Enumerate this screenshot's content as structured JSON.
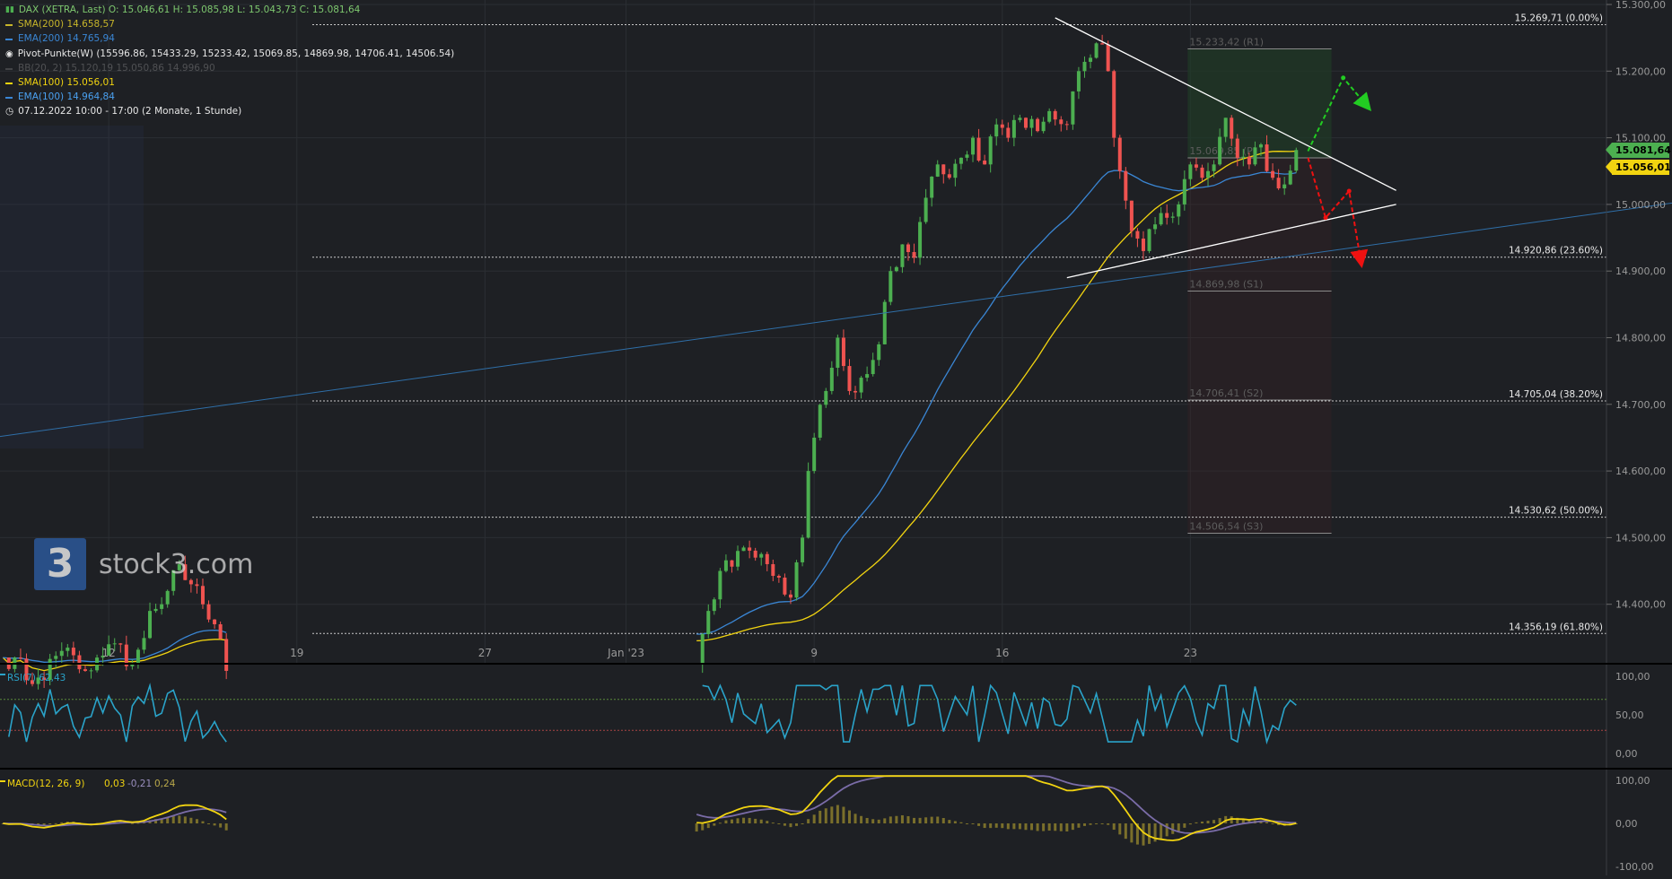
{
  "header": {
    "symbol_line": "DAX (XETRA, Last)  O: 15.046,61  H: 15.085,98  L: 15.043,73  C: 15.081,64",
    "sma200": "SMA(200)  14.658,57",
    "ema200": "EMA(200)  14.765,94",
    "pivot": "Pivot-Punkte(W)  (15596.86, 15433.29, 15233.42, 15069.85, 14869.98, 14706.41, 14506.54)",
    "pivot_dim": "BB(20, 2)  15.120,19  15.050,86  14.996,90",
    "sma100": "SMA(100)  15.056,01",
    "ema100": "EMA(100)  14.964,84",
    "period": "07.12.2022 10:00 - 17:00   (2 Monate, 1 Stunde)"
  },
  "brand": {
    "logo": "3",
    "name": "stock3.com"
  },
  "colors": {
    "background": "#1e2024",
    "up": "#4caf50",
    "down": "#ef5350",
    "sma100": "#f2d410",
    "ema100": "#3a86d4",
    "trend": "#ffffff",
    "bull_arrow": "#22cc22",
    "bear_arrow": "#ee1111",
    "rsi": "#2aa3c9",
    "macd": "#f2d410",
    "signal": "#7a6ca8",
    "hist": "#9a8a2e"
  },
  "price_tags": [
    {
      "label": "15.081,64",
      "value": 15081.64,
      "color": "#4caf50"
    },
    {
      "label": "15.056,01",
      "value": 15056.01,
      "color": "#f2d410"
    }
  ],
  "chart_data": {
    "type": "candlestick",
    "price_axis": {
      "ylim": [
        14300,
        15300
      ],
      "ticks": [
        {
          "label": "15.300,00",
          "value": 15300
        },
        {
          "label": "15.200,00",
          "value": 15200
        },
        {
          "label": "15.100,00",
          "value": 15100
        },
        {
          "label": "15.000,00",
          "value": 15000
        },
        {
          "label": "14.900,00",
          "value": 14900
        },
        {
          "label": "14.800,00",
          "value": 14800
        },
        {
          "label": "14.700,00",
          "value": 14700
        },
        {
          "label": "14.600,00",
          "value": 14600
        },
        {
          "label": "14.500,00",
          "value": 14500
        },
        {
          "label": "14.400,00",
          "value": 14400
        }
      ]
    },
    "x_axis": {
      "ticks": [
        {
          "label": "12",
          "bar": 18
        },
        {
          "label": "19",
          "bar": 50
        },
        {
          "label": "27",
          "bar": 82
        },
        {
          "label": "Jan '23",
          "bar": 106
        },
        {
          "label": "9",
          "bar": 138
        },
        {
          "label": "16",
          "bar": 170
        },
        {
          "label": "23",
          "bar": 202
        }
      ]
    },
    "fibonacci": [
      {
        "label": "15.269,71 (0.00%)",
        "value": 15269.71
      },
      {
        "label": "14.920,86 (23.60%)",
        "value": 14920.86
      },
      {
        "label": "14.705,04 (38.20%)",
        "value": 14705.04
      },
      {
        "label": "14.530,62 (50.00%)",
        "value": 14530.62
      },
      {
        "label": "14.356,19 (61.80%)",
        "value": 14356.19
      }
    ],
    "pivots": [
      {
        "label": "15.233,42 (R1)",
        "value": 15233.42
      },
      {
        "label": "15.069,85 (P)",
        "value": 15069.85
      },
      {
        "label": "14.869,98 (S1)",
        "value": 14869.98
      },
      {
        "label": "14.706,41 (S2)",
        "value": 14706.41
      },
      {
        "label": "14.506,54 (S3)",
        "value": 14506.54
      }
    ],
    "anchors": [
      {
        "bar": 0,
        "value": 14320
      },
      {
        "bar": 6,
        "value": 14290
      },
      {
        "bar": 10,
        "value": 14330
      },
      {
        "bar": 14,
        "value": 14300
      },
      {
        "bar": 16,
        "value": 14320
      },
      {
        "bar": 18,
        "value": 14340
      },
      {
        "bar": 22,
        "value": 14310
      },
      {
        "bar": 25,
        "value": 14390
      },
      {
        "bar": 28,
        "value": 14420
      },
      {
        "bar": 30,
        "value": 14460
      },
      {
        "bar": 32,
        "value": 14430
      },
      {
        "bar": 34,
        "value": 14400
      },
      {
        "bar": 36,
        "value": 14370
      },
      {
        "bar": 38,
        "value": 14300
      },
      {
        "bar": 118,
        "value": 14310
      },
      {
        "bar": 120,
        "value": 14390
      },
      {
        "bar": 122,
        "value": 14450
      },
      {
        "bar": 125,
        "value": 14480
      },
      {
        "bar": 128,
        "value": 14470
      },
      {
        "bar": 132,
        "value": 14440
      },
      {
        "bar": 134,
        "value": 14410
      },
      {
        "bar": 136,
        "value": 14500
      },
      {
        "bar": 137,
        "value": 14600
      },
      {
        "bar": 138,
        "value": 14650
      },
      {
        "bar": 140,
        "value": 14720
      },
      {
        "bar": 142,
        "value": 14800
      },
      {
        "bar": 144,
        "value": 14720
      },
      {
        "bar": 146,
        "value": 14740
      },
      {
        "bar": 149,
        "value": 14790
      },
      {
        "bar": 151,
        "value": 14900
      },
      {
        "bar": 153,
        "value": 14940
      },
      {
        "bar": 155,
        "value": 14920
      },
      {
        "bar": 157,
        "value": 15010
      },
      {
        "bar": 159,
        "value": 15060
      },
      {
        "bar": 161,
        "value": 15040
      },
      {
        "bar": 163,
        "value": 15070
      },
      {
        "bar": 165,
        "value": 15100
      },
      {
        "bar": 167,
        "value": 15060
      },
      {
        "bar": 169,
        "value": 15120
      },
      {
        "bar": 171,
        "value": 15100
      },
      {
        "bar": 173,
        "value": 15130
      },
      {
        "bar": 176,
        "value": 15110
      },
      {
        "bar": 178,
        "value": 15140
      },
      {
        "bar": 181,
        "value": 15120
      },
      {
        "bar": 183,
        "value": 15200
      },
      {
        "bar": 185,
        "value": 15220
      },
      {
        "bar": 187,
        "value": 15240
      },
      {
        "bar": 188,
        "value": 15200
      },
      {
        "bar": 189,
        "value": 15100
      },
      {
        "bar": 190,
        "value": 15050
      },
      {
        "bar": 192,
        "value": 14960
      },
      {
        "bar": 194,
        "value": 14930
      },
      {
        "bar": 196,
        "value": 14970
      },
      {
        "bar": 198,
        "value": 14980
      },
      {
        "bar": 200,
        "value": 15000
      },
      {
        "bar": 202,
        "value": 15060
      },
      {
        "bar": 204,
        "value": 15040
      },
      {
        "bar": 206,
        "value": 15060
      },
      {
        "bar": 208,
        "value": 15130
      },
      {
        "bar": 210,
        "value": 15070
      },
      {
        "bar": 212,
        "value": 15060
      },
      {
        "bar": 214,
        "value": 15090
      },
      {
        "bar": 216,
        "value": 15040
      },
      {
        "bar": 218,
        "value": 15030
      },
      {
        "bar": 220,
        "value": 15081.64
      }
    ],
    "trendlines": [
      {
        "name": "upper",
        "from": {
          "bar": 179,
          "value": 15280
        },
        "to": {
          "bar": 237,
          "value": 15021
        }
      },
      {
        "name": "lower",
        "from": {
          "bar": 181,
          "value": 14890
        },
        "to": {
          "bar": 237,
          "value": 15000
        }
      },
      {
        "name": "long",
        "from": {
          "bar": -2,
          "value": 14650
        },
        "to": {
          "bar": 292,
          "value": 15012
        }
      }
    ],
    "arrows": [
      {
        "kind": "bull",
        "points": [
          {
            "bar": 222,
            "value": 15080
          },
          {
            "bar": 228,
            "value": 15190
          },
          {
            "bar": 232,
            "value": 15148
          }
        ]
      },
      {
        "kind": "bear",
        "points": [
          {
            "bar": 222,
            "value": 15070
          },
          {
            "bar": 225,
            "value": 14980
          },
          {
            "bar": 229,
            "value": 15020
          },
          {
            "bar": 231,
            "value": 14915
          }
        ]
      }
    ],
    "rsi": {
      "label": "RSI(7)  62,43",
      "ticks": [
        {
          "label": "100,00",
          "value": 100
        },
        {
          "label": "50,00",
          "value": 50
        },
        {
          "label": "0,00",
          "value": 0
        }
      ],
      "levels": [
        70,
        30
      ],
      "last": 62.43
    },
    "macd": {
      "label": "MACD(12, 26, 9)",
      "values": [
        "0,03",
        "-0,21",
        "0,24"
      ],
      "ticks": [
        {
          "label": "100,00",
          "value": 100
        },
        {
          "label": "0,00",
          "value": 0
        },
        {
          "label": "-100,00",
          "value": -100
        }
      ]
    }
  }
}
